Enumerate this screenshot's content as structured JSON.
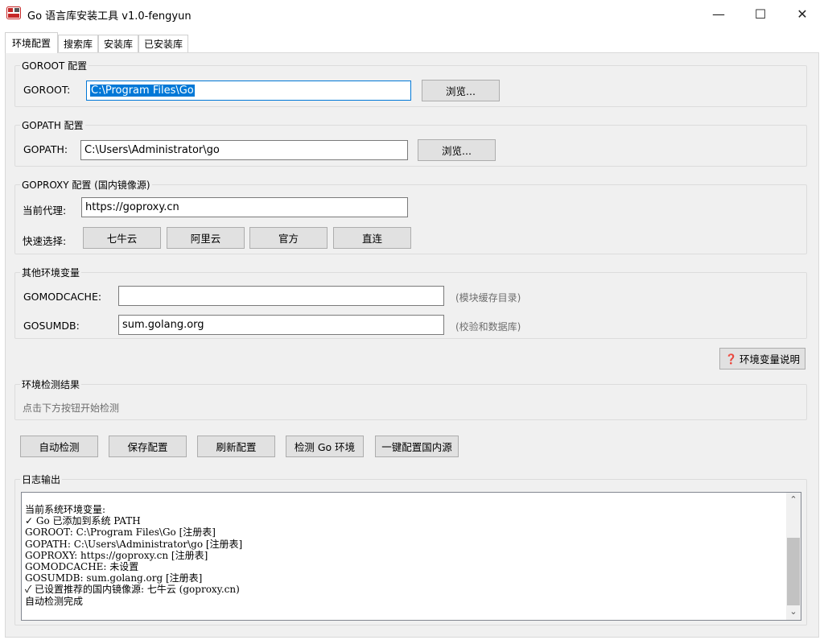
{
  "window": {
    "title": "Go 语言库安装工具 v1.0-fengyun",
    "minimize": "—",
    "maximize": "☐",
    "close": "✕"
  },
  "tabs": [
    "环境配置",
    "搜索库",
    "安装库",
    "已安装库"
  ],
  "goroot": {
    "group": "GOROOT 配置",
    "label": "GOROOT:",
    "value": "C:\\Program Files\\Go",
    "browse": "浏览..."
  },
  "gopath": {
    "group": "GOPATH 配置",
    "label": "GOPATH:",
    "value": "C:\\Users\\Administrator\\go",
    "browse": "浏览..."
  },
  "goproxy": {
    "group": "GOPROXY 配置 (国内镜像源)",
    "current_label": "当前代理:",
    "value": "https://goproxy.cn",
    "quick_label": "快速选择:",
    "options": [
      "七牛云",
      "阿里云",
      "官方",
      "直连"
    ]
  },
  "other_env": {
    "group": "其他环境变量",
    "gomodcache_label": "GOMODCACHE:",
    "gomodcache_value": "",
    "gomodcache_hint": "(模块缓存目录)",
    "gosumdb_label": "GOSUMDB:",
    "gosumdb_value": "sum.golang.org",
    "gosumdb_hint": "(校验和数据库)"
  },
  "env_help_button": "环境变量说明",
  "detect_result": {
    "group": "环境检测结果",
    "placeholder": "点击下方按钮开始检测"
  },
  "actions": [
    "自动检测",
    "保存配置",
    "刷新配置",
    "检测 Go 环境",
    "一键配置国内源"
  ],
  "log": {
    "group": "日志输出",
    "lines": [
      "当前系统环境变量:",
      "✓ Go 已添加到系统 PATH",
      "GOROOT: C:\\Program Files\\Go [注册表]",
      "GOPATH: C:\\Users\\Administrator\\go [注册表]",
      "GOPROXY: https://goproxy.cn [注册表]",
      "GOMODCACHE: 未设置",
      "GOSUMDB: sum.golang.org [注册表]",
      "✓ 已设置推荐的国内镜像源: 七牛云 (goproxy.cn)",
      "自动检测完成"
    ]
  },
  "colors": {
    "accent": "#0078d7",
    "panel": "#f0f0f0",
    "hint": "#6d6d6d"
  }
}
